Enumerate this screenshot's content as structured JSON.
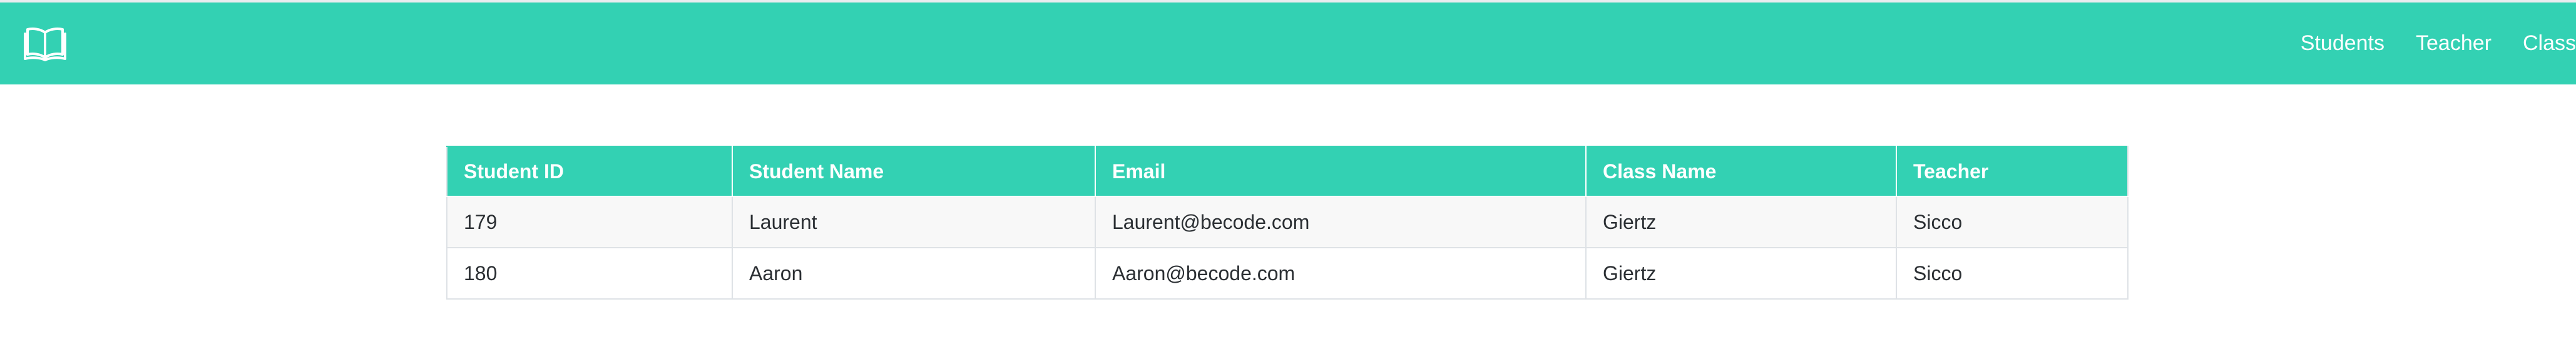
{
  "colors": {
    "navbar": "#33d1b3",
    "header": "#33d1b3",
    "stripe": "#f8f8f8",
    "border": "#dee2e6"
  },
  "nav": {
    "brand_icon": "open-book-icon",
    "links": [
      "Students",
      "Teacher",
      "Class"
    ]
  },
  "table": {
    "columns": [
      "Student ID",
      "Student Name",
      "Email",
      "Class Name",
      "Teacher"
    ],
    "rows": [
      [
        "179",
        "Laurent",
        "Laurent@becode.com",
        "Giertz",
        "Sicco"
      ],
      [
        "180",
        "Aaron",
        "Aaron@becode.com",
        "Giertz",
        "Sicco"
      ]
    ]
  }
}
